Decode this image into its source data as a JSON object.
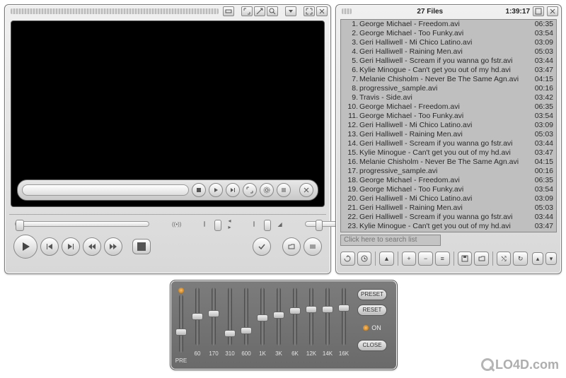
{
  "playlist": {
    "title_count": "27 Files",
    "total_time": "1:39:17",
    "search_placeholder": "Click here to search list",
    "items": [
      {
        "n": "1.",
        "name": "George Michael - Freedom.avi",
        "d": "06:35"
      },
      {
        "n": "2.",
        "name": "George Michael - Too Funky.avi",
        "d": "03:54"
      },
      {
        "n": "3.",
        "name": "Geri Halliwell - Mi Chico Latino.avi",
        "d": "03:09"
      },
      {
        "n": "4.",
        "name": "Geri Halliwell - Raining Men.avi",
        "d": "05:03"
      },
      {
        "n": "5.",
        "name": "Geri Halliwell - Scream if you wanna go fstr.avi",
        "d": "03:44"
      },
      {
        "n": "6.",
        "name": "Kylie Minogue - Can't get you out of my hd.avi",
        "d": "03:47"
      },
      {
        "n": "7.",
        "name": "Melanie Chisholm - Never Be The Same Agn.avi",
        "d": "04:15"
      },
      {
        "n": "8.",
        "name": "progressive_sample.avi",
        "d": "00:16"
      },
      {
        "n": "9.",
        "name": "Travis - Side.avi",
        "d": "03:42"
      },
      {
        "n": "10.",
        "name": "George Michael - Freedom.avi",
        "d": "06:35"
      },
      {
        "n": "11.",
        "name": "George Michael - Too Funky.avi",
        "d": "03:54"
      },
      {
        "n": "12.",
        "name": "Geri Halliwell - Mi Chico Latino.avi",
        "d": "03:09"
      },
      {
        "n": "13.",
        "name": "Geri Halliwell - Raining Men.avi",
        "d": "05:03"
      },
      {
        "n": "14.",
        "name": "Geri Halliwell - Scream if you wanna go fstr.avi",
        "d": "03:44"
      },
      {
        "n": "15.",
        "name": "Kylie Minogue - Can't get you out of my hd.avi",
        "d": "03:47"
      },
      {
        "n": "16.",
        "name": "Melanie Chisholm - Never Be The Same Agn.avi",
        "d": "04:15"
      },
      {
        "n": "17.",
        "name": "progressive_sample.avi",
        "d": "00:16"
      },
      {
        "n": "18.",
        "name": "George Michael - Freedom.avi",
        "d": "06:35"
      },
      {
        "n": "19.",
        "name": "George Michael - Too Funky.avi",
        "d": "03:54"
      },
      {
        "n": "20.",
        "name": "Geri Halliwell - Mi Chico Latino.avi",
        "d": "03:09"
      },
      {
        "n": "21.",
        "name": "Geri Halliwell - Raining Men.avi",
        "d": "05:03"
      },
      {
        "n": "22.",
        "name": "Geri Halliwell - Scream if you wanna go fstr.avi",
        "d": "03:44"
      },
      {
        "n": "23.",
        "name": "Kylie Minogue - Can't get you out of my hd.avi",
        "d": "03:47"
      }
    ]
  },
  "eq": {
    "preset_btn": "PRESET",
    "reset_btn": "RESET",
    "close_btn": "CLOSE",
    "on_label": "ON",
    "bands": [
      {
        "lbl": "PRE",
        "pos": 48
      },
      {
        "lbl": "60",
        "pos": 36
      },
      {
        "lbl": "170",
        "pos": 32
      },
      {
        "lbl": "310",
        "pos": 60
      },
      {
        "lbl": "600",
        "pos": 56
      },
      {
        "lbl": "1K",
        "pos": 38
      },
      {
        "lbl": "3K",
        "pos": 34
      },
      {
        "lbl": "6K",
        "pos": 28
      },
      {
        "lbl": "12K",
        "pos": 26
      },
      {
        "lbl": "14K",
        "pos": 26
      },
      {
        "lbl": "16K",
        "pos": 24
      }
    ]
  },
  "watermark": "LO4D.com"
}
